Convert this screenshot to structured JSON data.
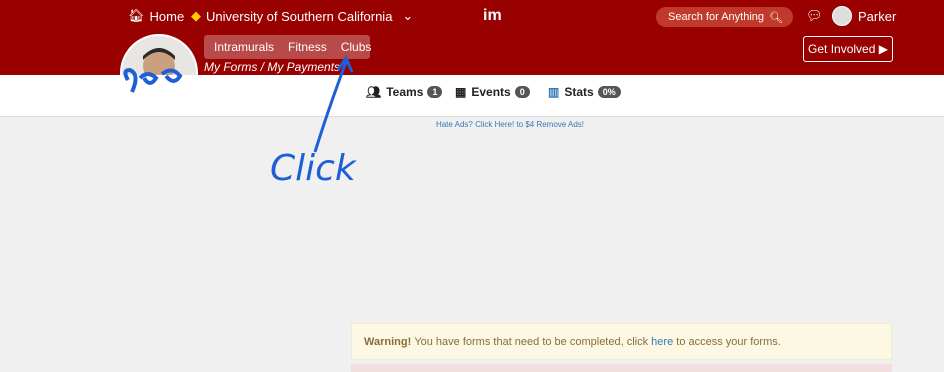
{
  "topnav": {
    "home_label": "Home",
    "school_label": "University of Southern California",
    "logo_text": "im",
    "search_placeholder": "Search for Anything",
    "user_name": "Parker"
  },
  "subnav": {
    "pills": [
      "Intramurals",
      "Fitness",
      "Clubs"
    ],
    "my_forms": "My Forms /",
    "my_payments": "My Payments",
    "get_involved": "Get Involved ▶"
  },
  "tabs": [
    {
      "label": "Teams",
      "badge": "1"
    },
    {
      "label": "Events",
      "badge": "0"
    },
    {
      "label": "Stats",
      "badge": "0%"
    }
  ],
  "ads_text": "Hate Ads? Click Here! to $4 Remove Ads!",
  "warning": {
    "strong": "Warning!",
    "text_before": "You have forms that need to be completed, click",
    "link": "here",
    "text_after": "to access your forms."
  },
  "annotation": {
    "text": "Click",
    "color": "#1f5fd6"
  }
}
